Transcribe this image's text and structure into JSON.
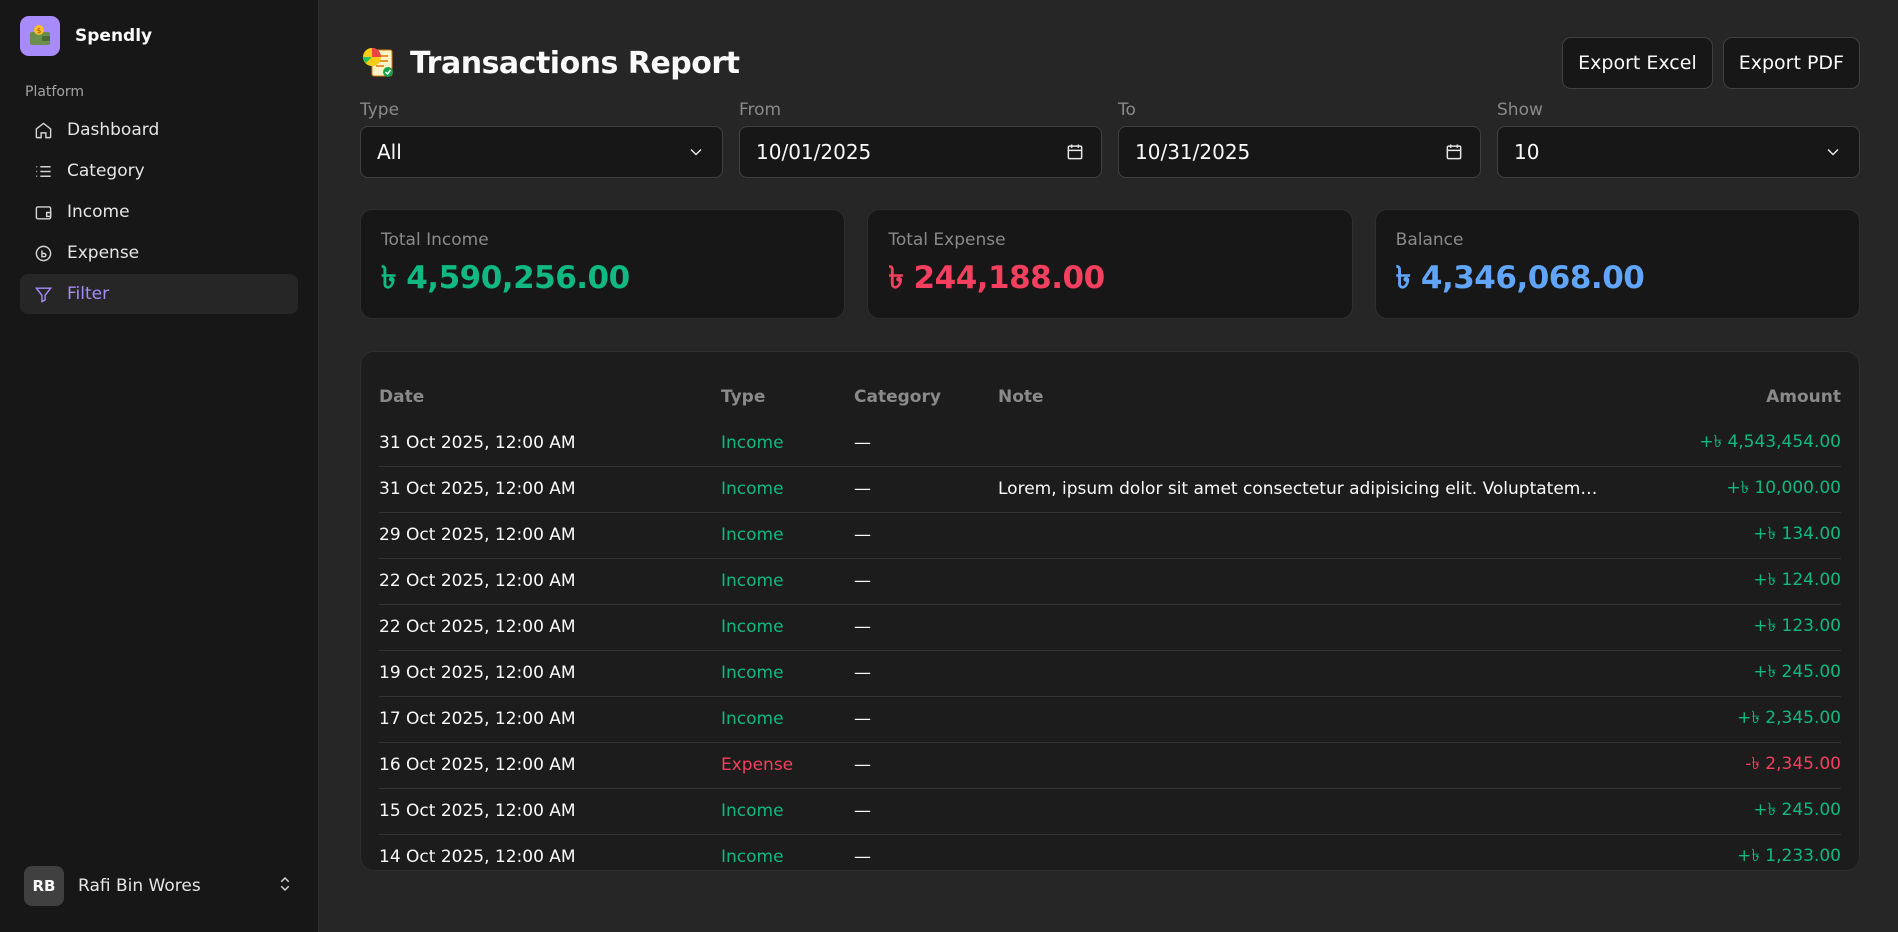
{
  "sidebar": {
    "brand": "Spendly",
    "section": "Platform",
    "items": [
      {
        "label": "Dashboard",
        "icon": "home-icon"
      },
      {
        "label": "Category",
        "icon": "list-icon"
      },
      {
        "label": "Income",
        "icon": "wallet-icon"
      },
      {
        "label": "Expense",
        "icon": "coin-icon"
      },
      {
        "label": "Filter",
        "icon": "filter-icon",
        "active": true
      }
    ],
    "user": {
      "initials": "RB",
      "name": "Rafi Bin Wores"
    }
  },
  "header": {
    "title": "Transactions Report",
    "export_excel": "Export Excel",
    "export_pdf": "Export PDF"
  },
  "filters": {
    "type": {
      "label": "Type",
      "value": "All"
    },
    "from": {
      "label": "From",
      "value": "10/01/2025"
    },
    "to": {
      "label": "To",
      "value": "10/31/2025"
    },
    "show": {
      "label": "Show",
      "value": "10"
    }
  },
  "summary": {
    "income": {
      "label": "Total Income",
      "value": "৳ 4,590,256.00",
      "color": "#10b981"
    },
    "expense": {
      "label": "Total Expense",
      "value": "৳ 244,188.00",
      "color": "#f43f5e"
    },
    "balance": {
      "label": "Balance",
      "value": "৳ 4,346,068.00",
      "color": "#60a5fa"
    }
  },
  "table": {
    "columns": [
      "Date",
      "Type",
      "Category",
      "Note",
      "Amount"
    ],
    "rows": [
      {
        "date": "31 Oct 2025, 12:00 AM",
        "type": "Income",
        "category": "—",
        "note": "",
        "amount": "+৳ 4,543,454.00"
      },
      {
        "date": "31 Oct 2025, 12:00 AM",
        "type": "Income",
        "category": "—",
        "note": "Lorem, ipsum dolor sit amet consectetur adipisicing elit. Voluptatem repre…",
        "amount": "+৳ 10,000.00"
      },
      {
        "date": "29 Oct 2025, 12:00 AM",
        "type": "Income",
        "category": "—",
        "note": "",
        "amount": "+৳ 134.00"
      },
      {
        "date": "22 Oct 2025, 12:00 AM",
        "type": "Income",
        "category": "—",
        "note": "",
        "amount": "+৳ 124.00"
      },
      {
        "date": "22 Oct 2025, 12:00 AM",
        "type": "Income",
        "category": "—",
        "note": "",
        "amount": "+৳ 123.00"
      },
      {
        "date": "19 Oct 2025, 12:00 AM",
        "type": "Income",
        "category": "—",
        "note": "",
        "amount": "+৳ 245.00"
      },
      {
        "date": "17 Oct 2025, 12:00 AM",
        "type": "Income",
        "category": "—",
        "note": "",
        "amount": "+৳ 2,345.00"
      },
      {
        "date": "16 Oct 2025, 12:00 AM",
        "type": "Expense",
        "category": "—",
        "note": "",
        "amount": "-৳ 2,345.00"
      },
      {
        "date": "15 Oct 2025, 12:00 AM",
        "type": "Income",
        "category": "—",
        "note": "",
        "amount": "+৳ 245.00"
      },
      {
        "date": "14 Oct 2025, 12:00 AM",
        "type": "Income",
        "category": "—",
        "note": "",
        "amount": "+৳ 1,233.00"
      }
    ]
  }
}
